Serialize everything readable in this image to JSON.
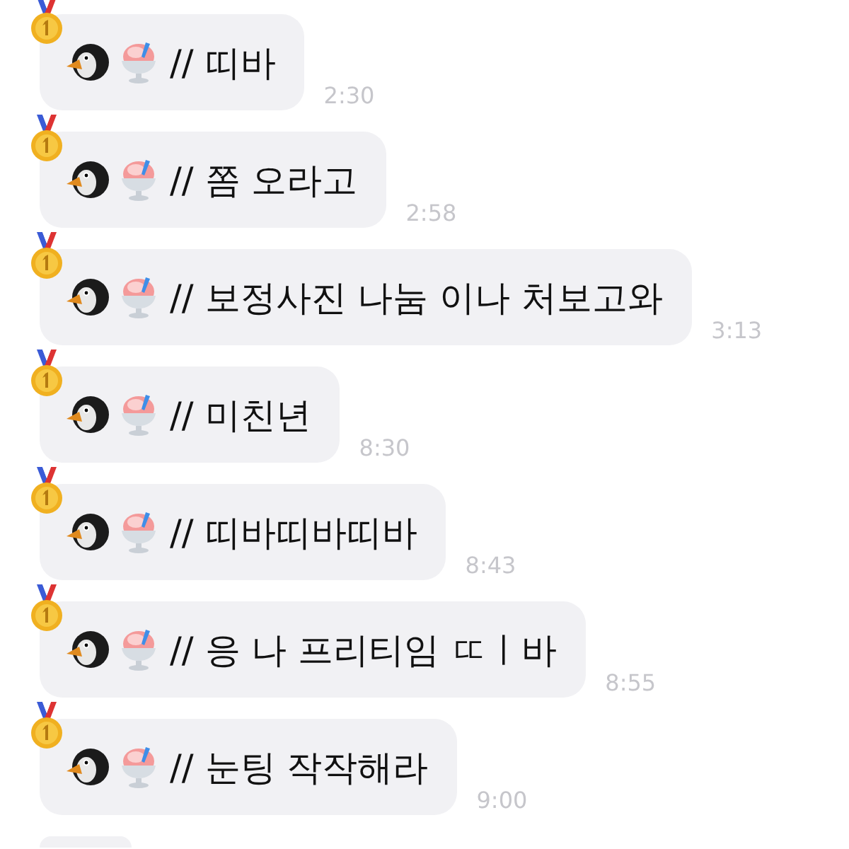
{
  "messages": [
    {
      "kind": "message",
      "text": "// 띠바",
      "time": "2:30"
    },
    {
      "kind": "message",
      "text": "// 쫌 오라고",
      "time": "2:58"
    },
    {
      "kind": "message",
      "text": "// 보정사진 나눔 이나 처보고와",
      "time": "3:13"
    },
    {
      "kind": "message",
      "text": "// 미친년",
      "time": "8:30"
    },
    {
      "kind": "message",
      "text": "// 띠바띠바띠바",
      "time": "8:43"
    },
    {
      "kind": "message",
      "text": "// 응 나 프리티임 ㄸㅣ바",
      "time": "8:55"
    },
    {
      "kind": "message",
      "text": "// 눈팅 작작해라",
      "time": "9:00"
    },
    {
      "kind": "partial"
    }
  ]
}
